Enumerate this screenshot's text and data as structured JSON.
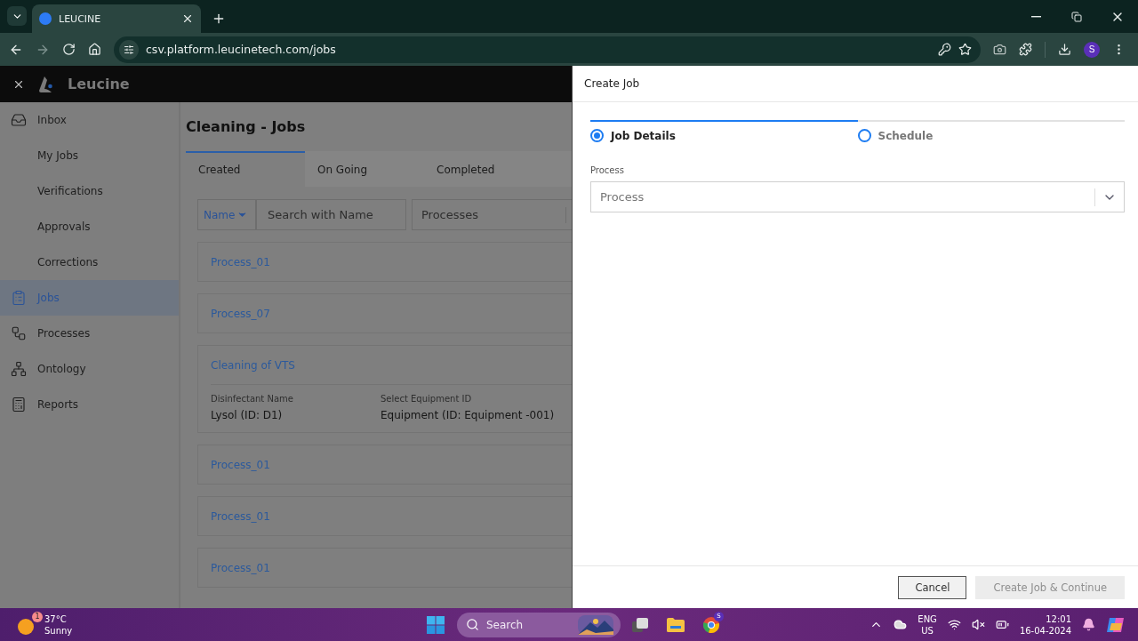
{
  "browser": {
    "tab_title": "LEUCINE",
    "url": "csv.platform.leucinetech.com/jobs",
    "profile": "S"
  },
  "app": {
    "brand": "Leucine",
    "sidebar": {
      "items": [
        {
          "label": "Inbox",
          "kind": "main",
          "selected": false
        },
        {
          "label": "My Jobs",
          "kind": "sub",
          "selected": false
        },
        {
          "label": "Verifications",
          "kind": "sub",
          "selected": false
        },
        {
          "label": "Approvals",
          "kind": "sub",
          "selected": false
        },
        {
          "label": "Corrections",
          "kind": "sub",
          "selected": false
        },
        {
          "label": "Jobs",
          "kind": "main",
          "selected": true
        },
        {
          "label": "Processes",
          "kind": "main",
          "selected": false
        },
        {
          "label": "Ontology",
          "kind": "main",
          "selected": false
        },
        {
          "label": "Reports",
          "kind": "main",
          "selected": false
        }
      ]
    },
    "page_title": "Cleaning - Jobs",
    "tabs": [
      {
        "label": "Created",
        "selected": true
      },
      {
        "label": "On Going",
        "selected": false
      },
      {
        "label": "Completed",
        "selected": false
      }
    ],
    "filter": {
      "field": "Name",
      "search": {
        "placeholder": "Search with Name"
      },
      "processes": {
        "placeholder": "Processes"
      }
    },
    "jobs": [
      {
        "title": "Process_01"
      },
      {
        "title": "Process_07"
      },
      {
        "title": "Cleaning of VTS",
        "fields": [
          {
            "label": "Disinfectant Name",
            "value": "Lysol (ID: D1)"
          },
          {
            "label": "Select Equipment ID",
            "value": "Equipment (ID: Equipment -001)"
          }
        ]
      },
      {
        "title": "Process_01"
      },
      {
        "title": "Process_01"
      },
      {
        "title": "Process_01"
      }
    ]
  },
  "drawer": {
    "title": "Create Job",
    "steps": [
      {
        "label": "Job Details",
        "selected": true
      },
      {
        "label": "Schedule",
        "selected": false
      }
    ],
    "process_label": "Process",
    "process_select": {
      "placeholder": "Process"
    },
    "buttons": [
      {
        "label": "Cancel",
        "disabled": false
      },
      {
        "label": "Create Job & Continue",
        "disabled": true
      }
    ]
  },
  "taskbar": {
    "weather": {
      "badge": "1",
      "temp": "37°C",
      "condition": "Sunny"
    },
    "search": {
      "placeholder": "Search"
    },
    "chrome_badge": "S",
    "language": "ENG",
    "region": "US",
    "time": "12:01",
    "date": "16-04-2024"
  }
}
